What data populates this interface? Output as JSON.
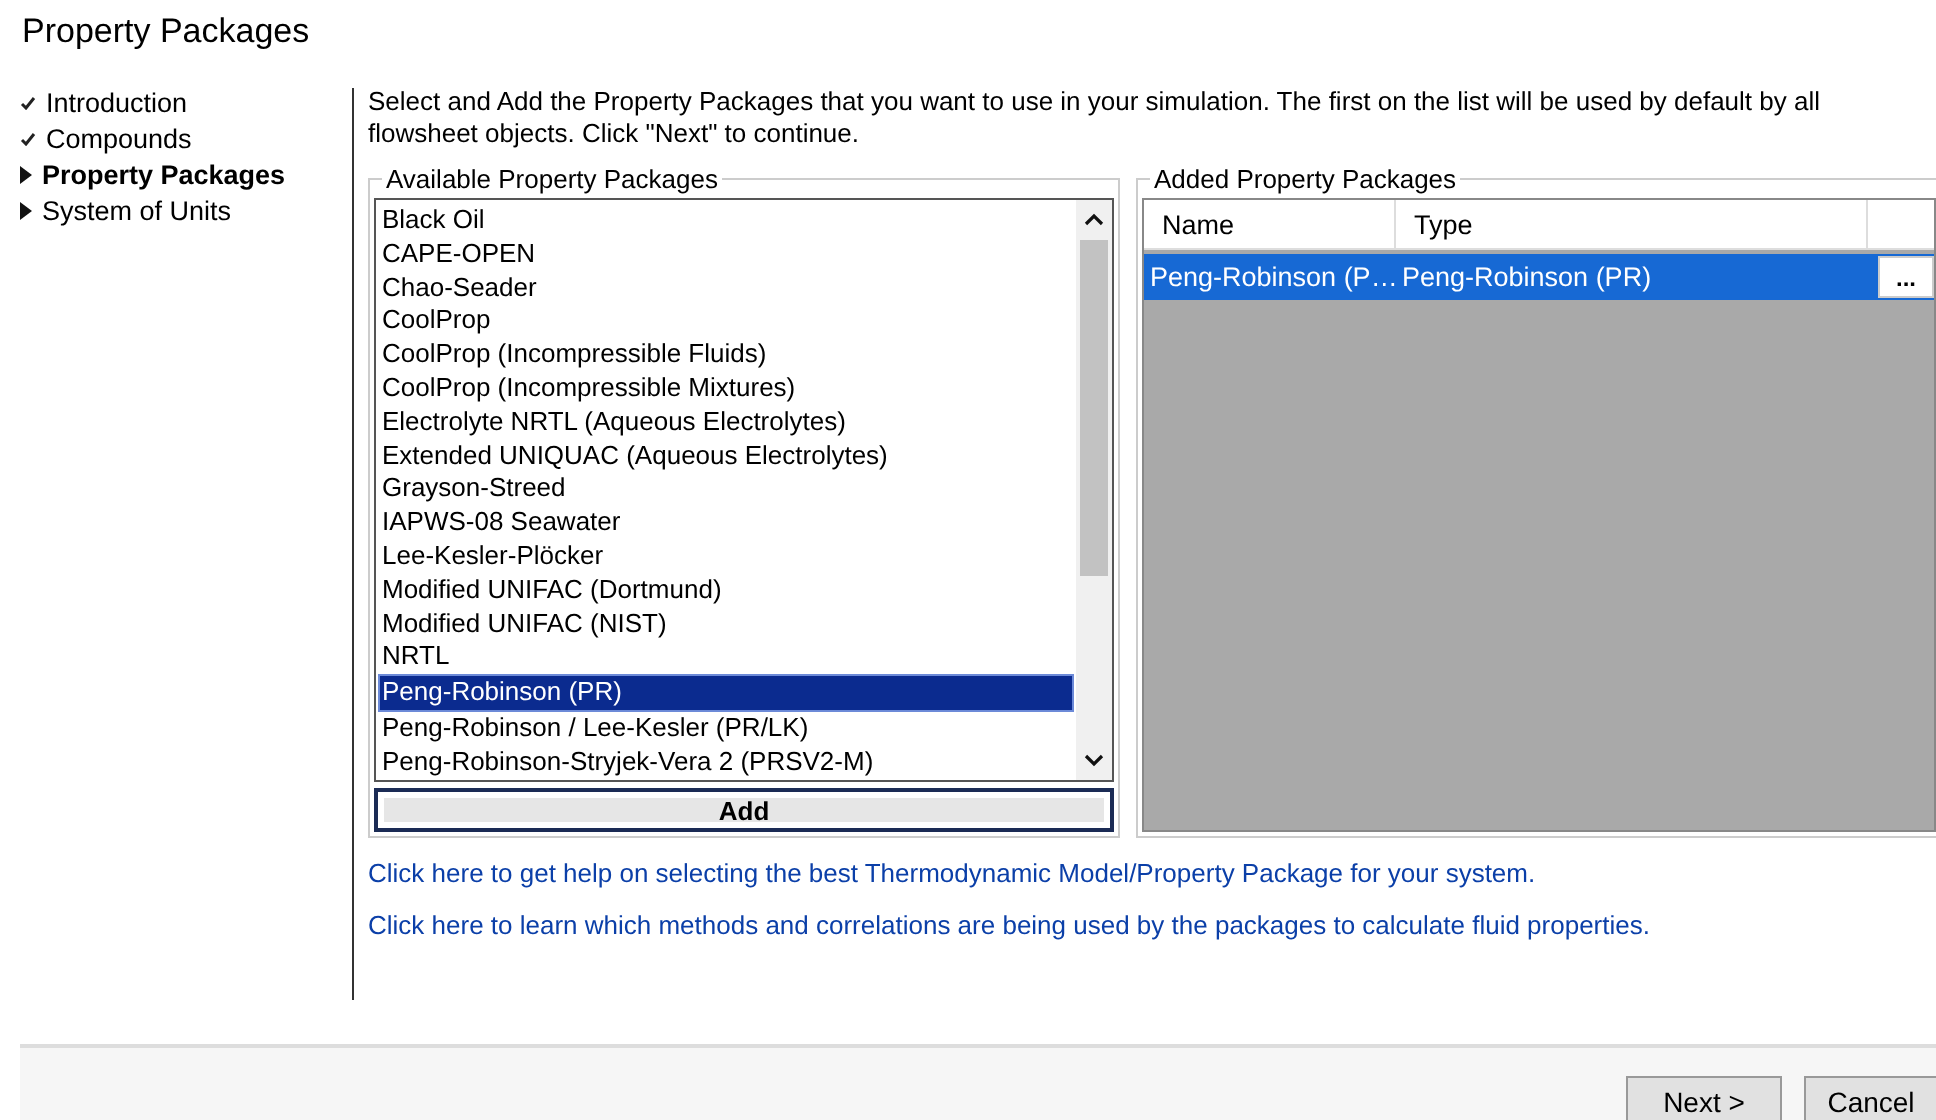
{
  "window": {
    "title": "Property Packages"
  },
  "steps": [
    {
      "label": "Introduction",
      "kind": "done",
      "selected": false
    },
    {
      "label": "Compounds",
      "kind": "done",
      "selected": false
    },
    {
      "label": "Property Packages",
      "kind": "pending",
      "selected": true
    },
    {
      "label": "System of Units",
      "kind": "pending",
      "selected": false
    }
  ],
  "description": "Select and Add the Property Packages that you want to use in your simulation. The first on the list will be used by default by all flowsheet objects. Click \"Next\" to continue.",
  "available": {
    "title": "Available Property Packages",
    "items": [
      {
        "label": "Black Oil",
        "selected": false
      },
      {
        "label": "CAPE-OPEN",
        "selected": false
      },
      {
        "label": "Chao-Seader",
        "selected": false
      },
      {
        "label": "CoolProp",
        "selected": false
      },
      {
        "label": "CoolProp (Incompressible Fluids)",
        "selected": false
      },
      {
        "label": "CoolProp (Incompressible Mixtures)",
        "selected": false
      },
      {
        "label": "Electrolyte NRTL (Aqueous Electrolytes)",
        "selected": false
      },
      {
        "label": "Extended UNIQUAC (Aqueous Electrolytes)",
        "selected": false
      },
      {
        "label": "Grayson-Streed",
        "selected": false
      },
      {
        "label": "IAPWS-08 Seawater",
        "selected": false
      },
      {
        "label": "Lee-Kesler-Plöcker",
        "selected": false
      },
      {
        "label": "Modified UNIFAC (Dortmund)",
        "selected": false
      },
      {
        "label": "Modified UNIFAC (NIST)",
        "selected": false
      },
      {
        "label": "NRTL",
        "selected": false
      },
      {
        "label": "Peng-Robinson (PR)",
        "selected": true
      },
      {
        "label": "Peng-Robinson / Lee-Kesler (PR/LK)",
        "selected": false
      },
      {
        "label": "Peng-Robinson-Stryjek-Vera 2 (PRSV2-M)",
        "selected": false
      }
    ],
    "add_button": "Add"
  },
  "added": {
    "title": "Added Property Packages",
    "columns": [
      "Name",
      "Type"
    ],
    "rows": [
      {
        "name": "Peng-Robinson (P…",
        "type": "Peng-Robinson (PR)",
        "button": "...",
        "selected": true
      }
    ]
  },
  "links": [
    "Click here to get help on selecting the best Thermodynamic Model/Property Package for your system.",
    "Click here to learn which methods and correlations are being used by the packages to calculate fluid properties."
  ],
  "buttons": [
    "Next >",
    "Cancel"
  ]
}
